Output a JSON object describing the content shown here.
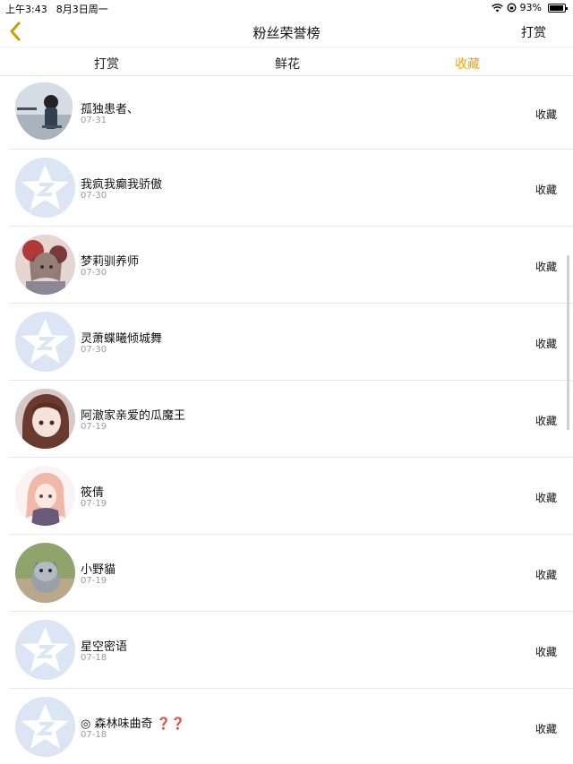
{
  "status_bar": {
    "time": "上午3:43",
    "date": "8月3日周一",
    "battery_text": "93%",
    "battery_level": 0.93
  },
  "nav": {
    "title": "粉丝荣誉榜",
    "right_action": "打赏"
  },
  "tabs": [
    {
      "label": "打赏",
      "active": false
    },
    {
      "label": "鲜花",
      "active": false
    },
    {
      "label": "收藏",
      "active": true
    }
  ],
  "colors": {
    "accent": "#f0a500",
    "default_avatar_bg": "#dbe5f3"
  },
  "list": [
    {
      "name": "孤独患者、",
      "date": "07-31",
      "action": "收藏",
      "avatar": "photo-girl-outdoor"
    },
    {
      "name": "我疯我癫我骄傲",
      "date": "07-30",
      "action": "收藏",
      "avatar": "default-qq-star"
    },
    {
      "name": "梦莉驯养师",
      "date": "07-30",
      "action": "收藏",
      "avatar": "anime-girl-flowers"
    },
    {
      "name": "灵萧蝶曦倾城舞",
      "date": "07-30",
      "action": "收藏",
      "avatar": "default-qq-star"
    },
    {
      "name": "阿澈家亲爱的瓜魔王",
      "date": "07-19",
      "action": "收藏",
      "avatar": "anime-girl-brown-hair"
    },
    {
      "name": "筱倩",
      "date": "07-19",
      "action": "收藏",
      "avatar": "anime-girl-pink"
    },
    {
      "name": "小野貓",
      "date": "07-19",
      "action": "收藏",
      "avatar": "kitten-photo"
    },
    {
      "name": "星空密语",
      "date": "07-18",
      "action": "收藏",
      "avatar": "default-qq-star"
    },
    {
      "name": "◎ 森林味曲奇 ❓❓",
      "date": "07-18",
      "action": "收藏",
      "avatar": "default-qq-star"
    }
  ]
}
